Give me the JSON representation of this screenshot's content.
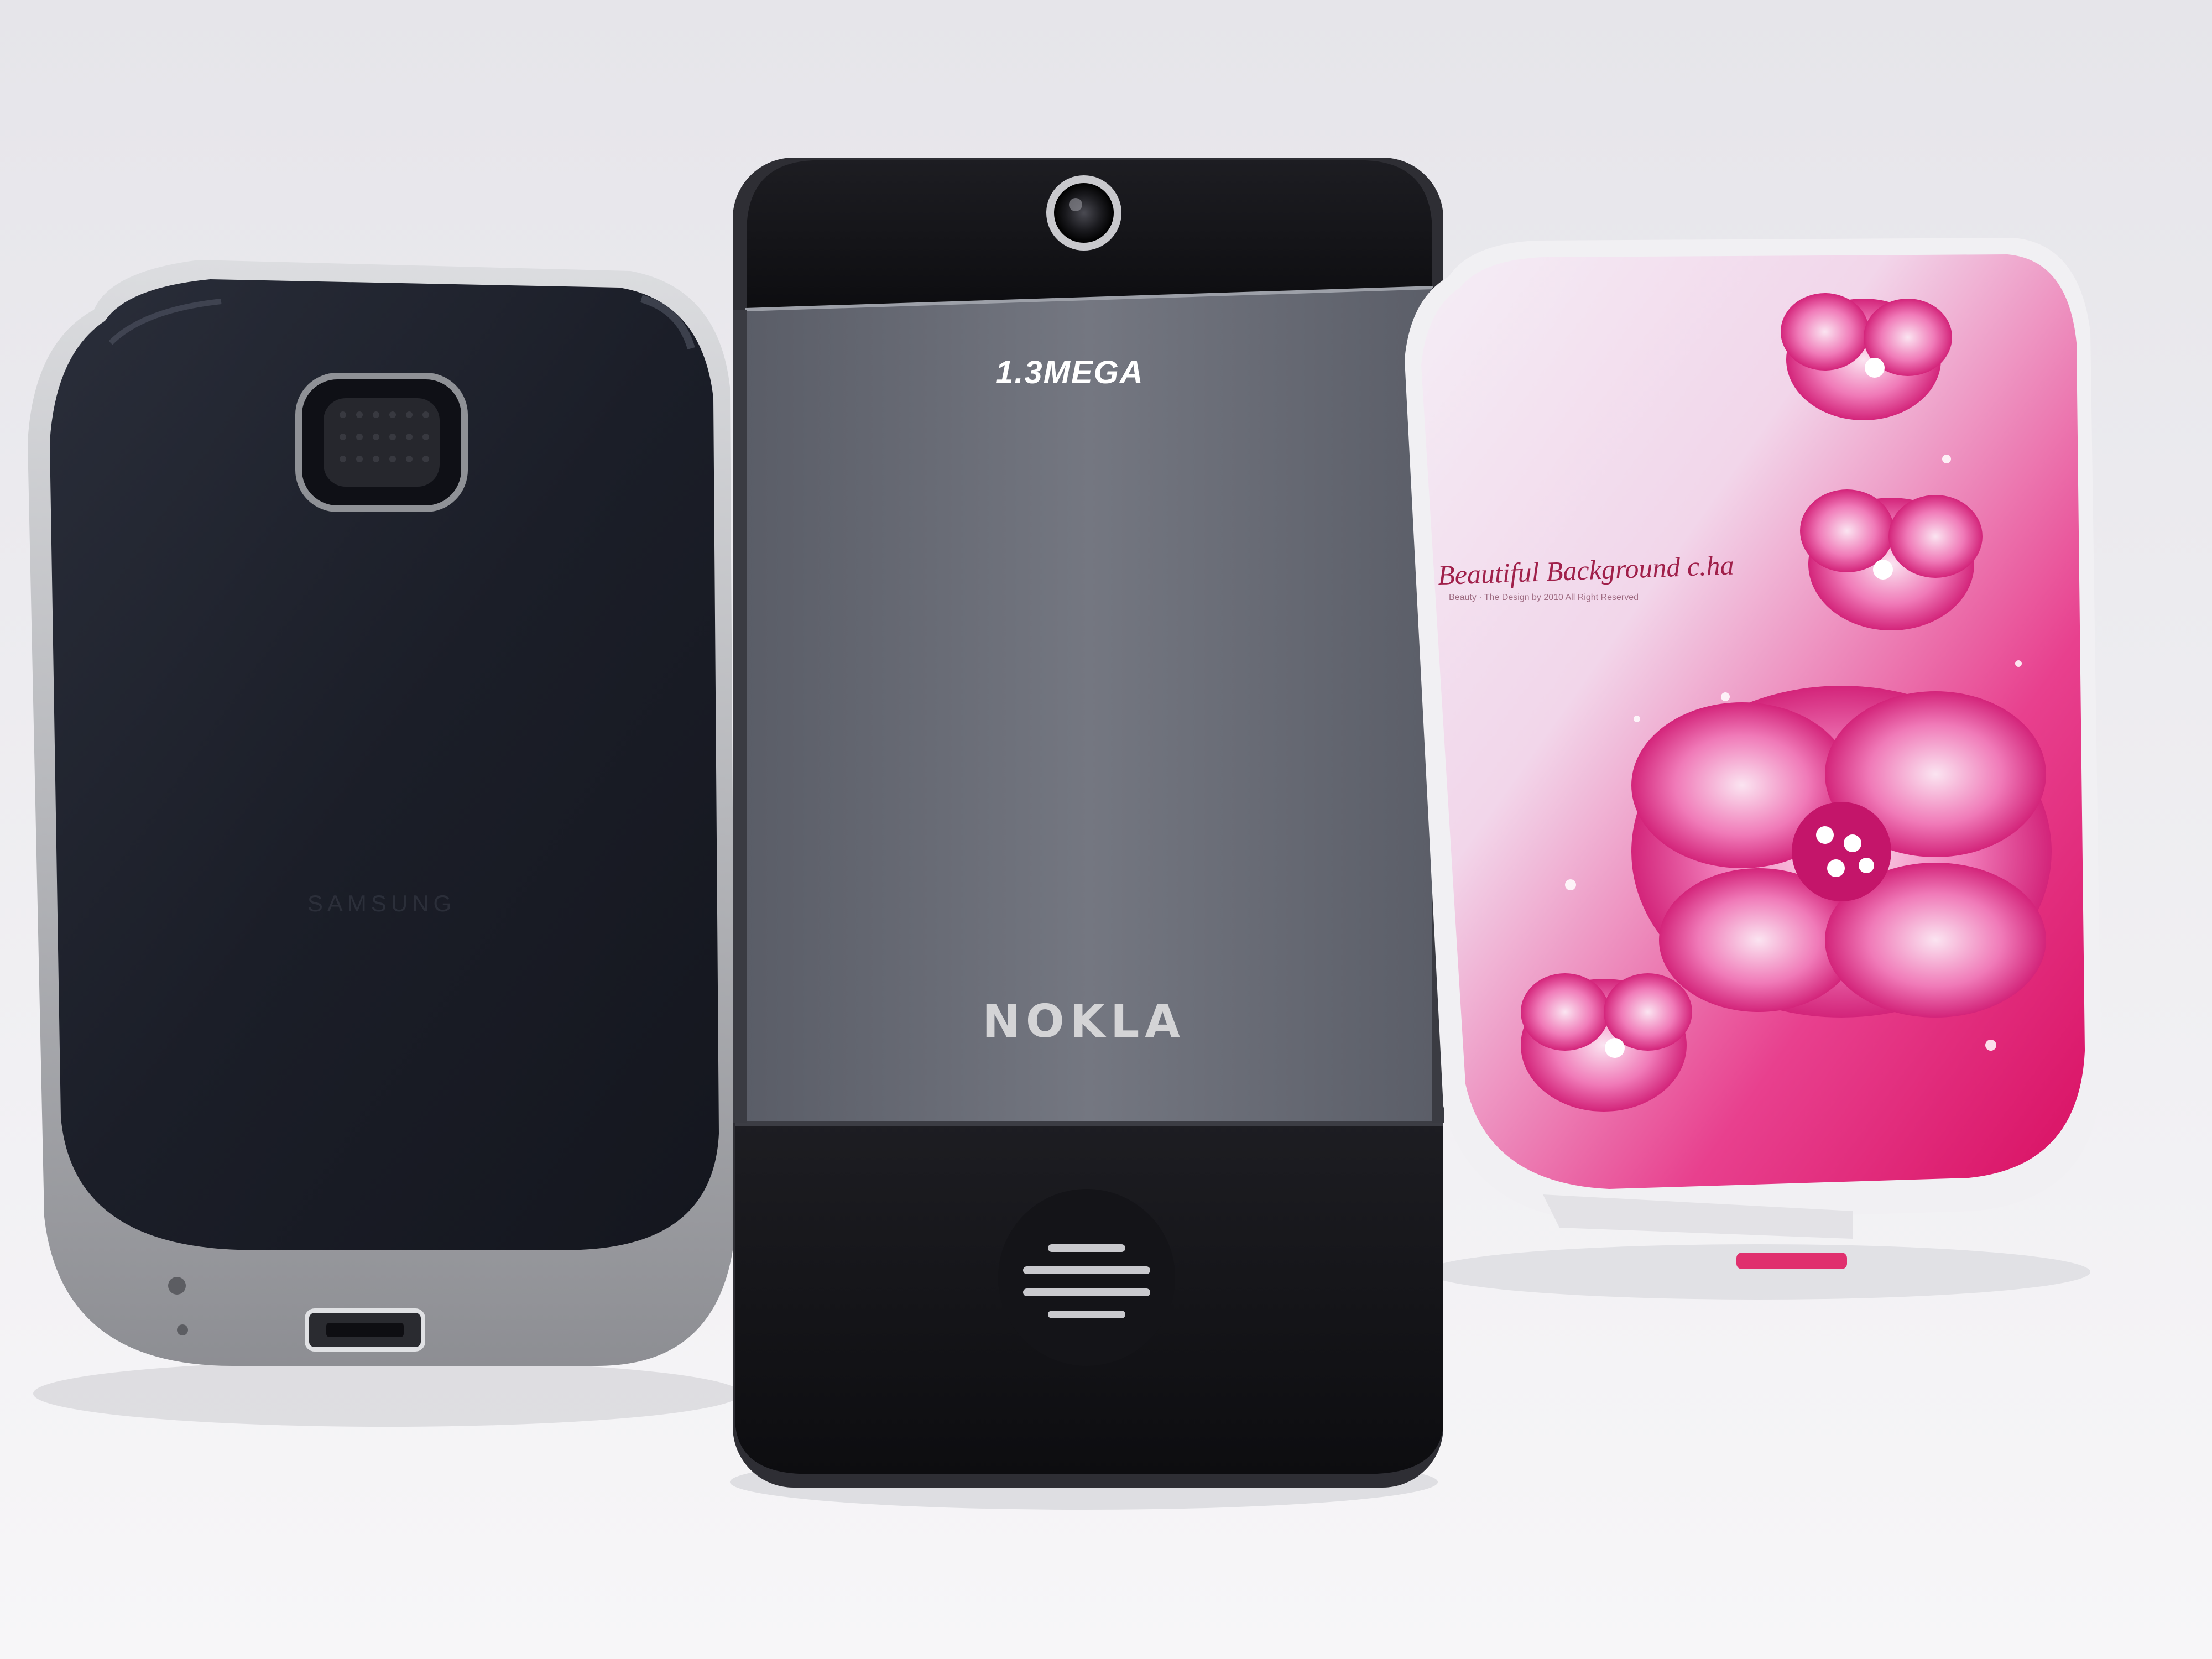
{
  "photo": {
    "subject": "three-mobile-phones-back-view",
    "colors": {
      "background": "#efeef1",
      "left_phone_shell": "#1c1f2a",
      "left_phone_bezel": "#c9cacd",
      "middle_phone_panel": "#6b6e78",
      "middle_phone_caps": "#141418",
      "right_phone_pink": "#e0166a",
      "right_phone_white": "#f4f0f6"
    }
  },
  "middle_phone": {
    "camera_spec": "1.3MEGA",
    "brand": "NOKLA"
  },
  "left_phone": {
    "embossed_logo": "SAMSUNG"
  },
  "right_phone": {
    "decoration_text": "Beautiful Background c.ha",
    "decoration_fine_print": "Beauty · The Design by 2010 All Right Reserved"
  }
}
